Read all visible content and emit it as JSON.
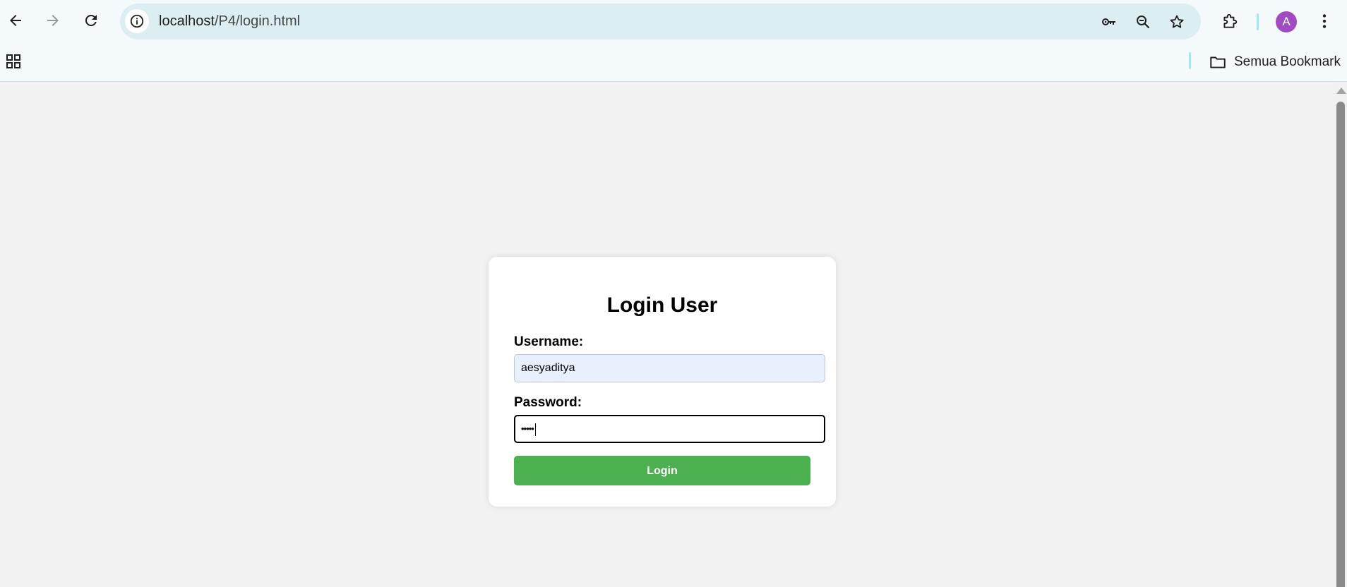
{
  "browser": {
    "url_host": "localhost",
    "url_path": "/P4/login.html",
    "profile_initial": "A",
    "profile_color": "#a04bc1",
    "bookmarks_folder_label": "Semua Bookmark"
  },
  "login_form": {
    "title": "Login User",
    "username_label": "Username:",
    "username_value": "aesyaditya",
    "password_label": "Password:",
    "password_value": "•••••",
    "submit_label": "Login",
    "button_color": "#4caf50"
  },
  "icons": {
    "back": "arrow-left-icon",
    "forward": "arrow-right-icon",
    "reload": "reload-icon",
    "site_info": "info-icon",
    "password_manager": "key-icon",
    "zoom": "zoom-out-icon",
    "bookmark_star": "star-icon",
    "extensions": "puzzle-icon",
    "menu": "kebab-menu-icon",
    "apps": "apps-grid-icon",
    "folder": "folder-icon"
  }
}
